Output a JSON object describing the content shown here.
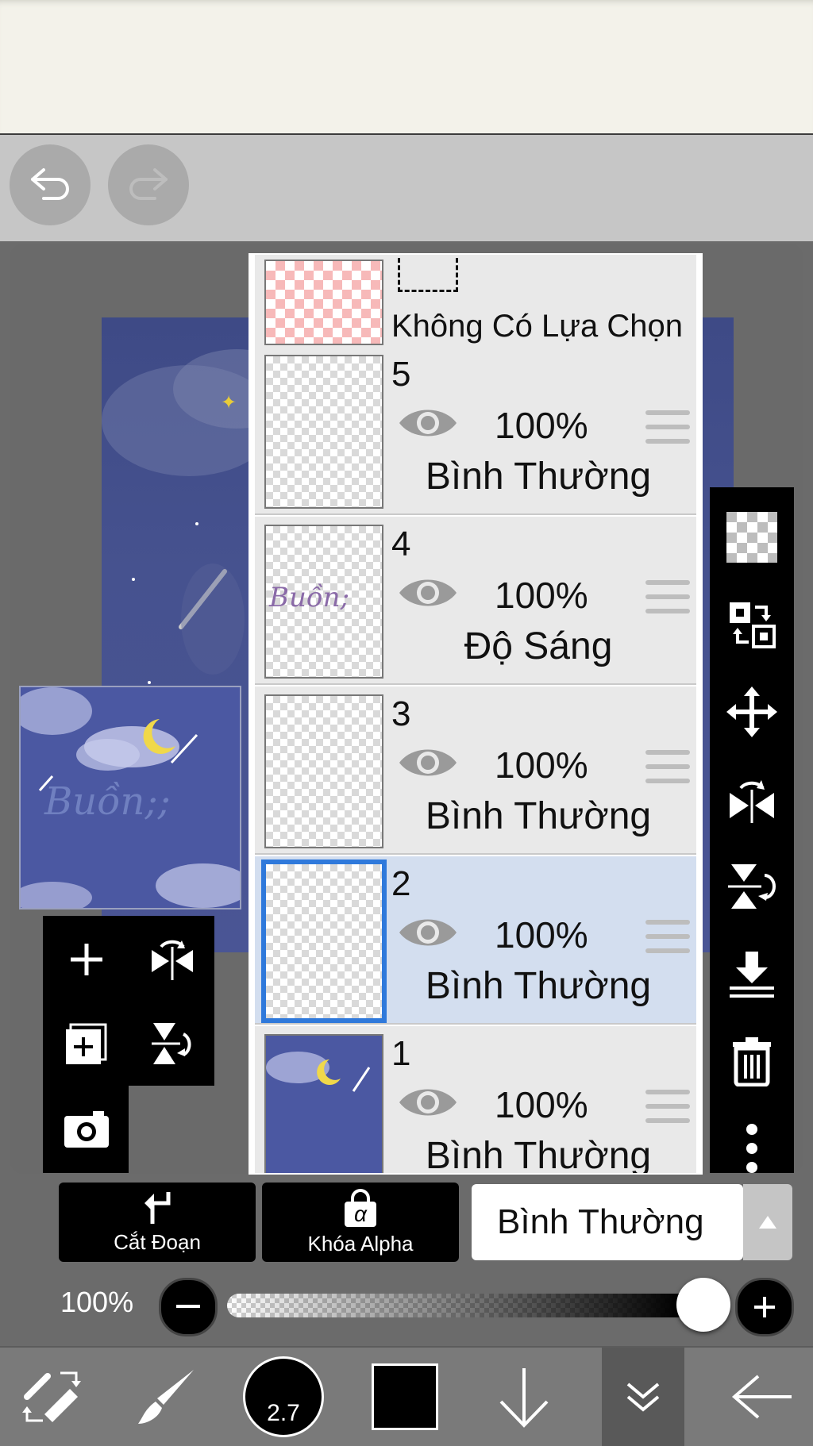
{
  "toolbar": {
    "undo_icon": "undo-icon",
    "redo_icon": "redo-icon"
  },
  "layers": {
    "selection_label": "Không Có Lựa Chọn",
    "items": [
      {
        "number": "5",
        "opacity": "100%",
        "blend": "Bình Thường",
        "thumb_text": ""
      },
      {
        "number": "4",
        "opacity": "100%",
        "blend": "Độ Sáng",
        "thumb_text": "Buồn;"
      },
      {
        "number": "3",
        "opacity": "100%",
        "blend": "Bình Thường",
        "thumb_text": ""
      },
      {
        "number": "2",
        "opacity": "100%",
        "blend": "Bình Thường",
        "thumb_text": ""
      },
      {
        "number": "1",
        "opacity": "100%",
        "blend": "Bình Thường",
        "thumb_text": ""
      }
    ],
    "selected_number": "2"
  },
  "preview": {
    "text": "Buồn;;"
  },
  "buttons": {
    "clipping_label": "Cắt Đoạn",
    "alpha_lock_label": "Khóa Alpha",
    "alpha_symbol": "α",
    "blend_mode": "Bình Thường"
  },
  "opacity_slider": {
    "label": "100%",
    "value": 1.0
  },
  "bottom_bar": {
    "brush_size": "2.7",
    "color": "#000000"
  },
  "colors": {
    "selected_border": "#2f79db",
    "selected_row": "#d3deef",
    "canvas_bg": "#46528f"
  }
}
